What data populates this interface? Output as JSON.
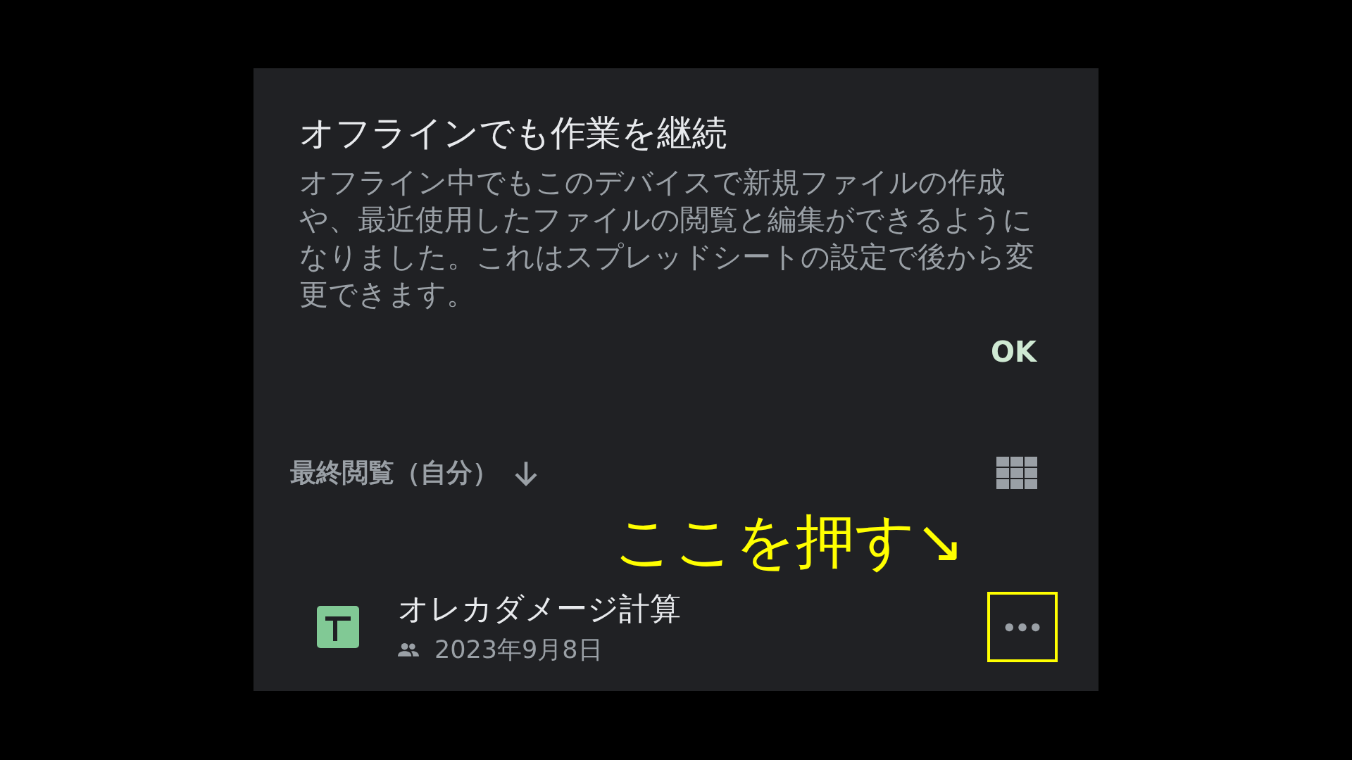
{
  "dialog": {
    "title": "オフラインでも作業を継続",
    "message": "オフライン中でもこのデバイスで新規ファイルの作成や、最近使用したファイルの閲覧と編集ができるようになりました。これはスプレッドシートの設定で後から変更できます。",
    "ok_button": "OK"
  },
  "sort_bar": {
    "label": "最終閲覧（自分）"
  },
  "annotation": {
    "text": "ここを押す↘"
  },
  "files": [
    {
      "name": "オレカダメージ計算",
      "date": "2023年9月8日",
      "shared": true,
      "highlighted": true
    }
  ]
}
